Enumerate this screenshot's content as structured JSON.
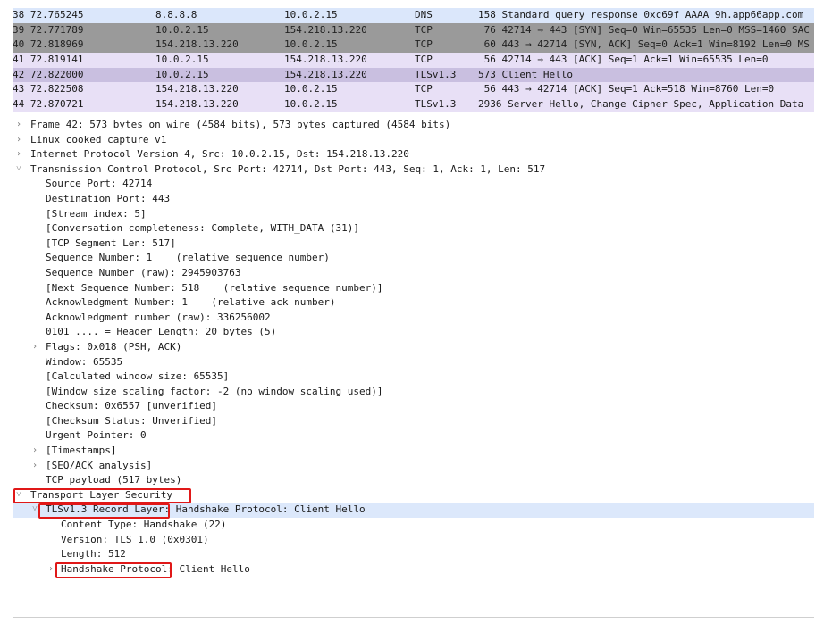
{
  "packet_list": {
    "rows": [
      {
        "no": "38 72.765245",
        "src": "8.8.8.8",
        "dst": "10.0.2.15",
        "proto": "DNS",
        "len_info": "158 Standard query response 0xc69f AAAA 9h.app66app.com"
      },
      {
        "no": "39 72.771789",
        "src": "10.0.2.15",
        "dst": "154.218.13.220",
        "proto": "TCP",
        "len_info": " 76 42714 → 443 [SYN] Seq=0 Win=65535 Len=0 MSS=1460 SAC"
      },
      {
        "no": "40 72.818969",
        "src": "154.218.13.220",
        "dst": "10.0.2.15",
        "proto": "TCP",
        "len_info": " 60 443 → 42714 [SYN, ACK] Seq=0 Ack=1 Win=8192 Len=0 MS"
      },
      {
        "no": "41 72.819141",
        "src": "10.0.2.15",
        "dst": "154.218.13.220",
        "proto": "TCP",
        "len_info": " 56 42714 → 443 [ACK] Seq=1 Ack=1 Win=65535 Len=0"
      },
      {
        "no": "42 72.822000",
        "src": "10.0.2.15",
        "dst": "154.218.13.220",
        "proto": "TLSv1.3",
        "len_info": "573 Client Hello"
      },
      {
        "no": "43 72.822508",
        "src": "154.218.13.220",
        "dst": "10.0.2.15",
        "proto": "TCP",
        "len_info": " 56 443 → 42714 [ACK] Seq=1 Ack=518 Win=8760 Len=0"
      },
      {
        "no": "44 72.870721",
        "src": "154.218.13.220",
        "dst": "10.0.2.15",
        "proto": "TLSv1.3",
        "len_info": "2936 Server Hello, Change Cipher Spec, Application Data"
      }
    ]
  },
  "details": {
    "frame": "Frame 42: 573 bytes on wire (4584 bits), 573 bytes captured (4584 bits)",
    "linux": "Linux cooked capture v1",
    "ip": "Internet Protocol Version 4, Src: 10.0.2.15, Dst: 154.218.13.220",
    "tcp": "Transmission Control Protocol, Src Port: 42714, Dst Port: 443, Seq: 1, Ack: 1, Len: 517",
    "tcp_fields": [
      "Source Port: 42714",
      "Destination Port: 443",
      "[Stream index: 5]",
      "[Conversation completeness: Complete, WITH_DATA (31)]",
      "[TCP Segment Len: 517]",
      "Sequence Number: 1    (relative sequence number)",
      "Sequence Number (raw): 2945903763",
      "[Next Sequence Number: 518    (relative sequence number)]",
      "Acknowledgment Number: 1    (relative ack number)",
      "Acknowledgment number (raw): 336256002",
      "0101 .... = Header Length: 20 bytes (5)"
    ],
    "flags": "Flags: 0x018 (PSH, ACK)",
    "tcp_fields2": [
      "Window: 65535",
      "[Calculated window size: 65535]",
      "[Window size scaling factor: -2 (no window scaling used)]",
      "Checksum: 0x6557 [unverified]",
      "[Checksum Status: Unverified]",
      "Urgent Pointer: 0"
    ],
    "timestamps": "[Timestamps]",
    "seqack": "[SEQ/ACK analysis]",
    "payload": "TCP payload (517 bytes)",
    "tls": "Transport Layer Security",
    "record": "TLSv1.3 Record Layer: Handshake Protocol: Client Hello",
    "record_fields": [
      "Content Type: Handshake (22)",
      "Version: TLS 1.0 (0x0301)",
      "Length: 512"
    ],
    "handshake": "Handshake Protocol: Client Hello"
  },
  "icons": {
    "collapsed": "chevron-right-icon",
    "expanded": "chevron-down-icon"
  },
  "colors": {
    "highlight_box": "#e01818",
    "dns_row": "#dbe7fb",
    "selected_row": "#c9bfe0",
    "tcp_dark_row": "#9a9a9a"
  }
}
